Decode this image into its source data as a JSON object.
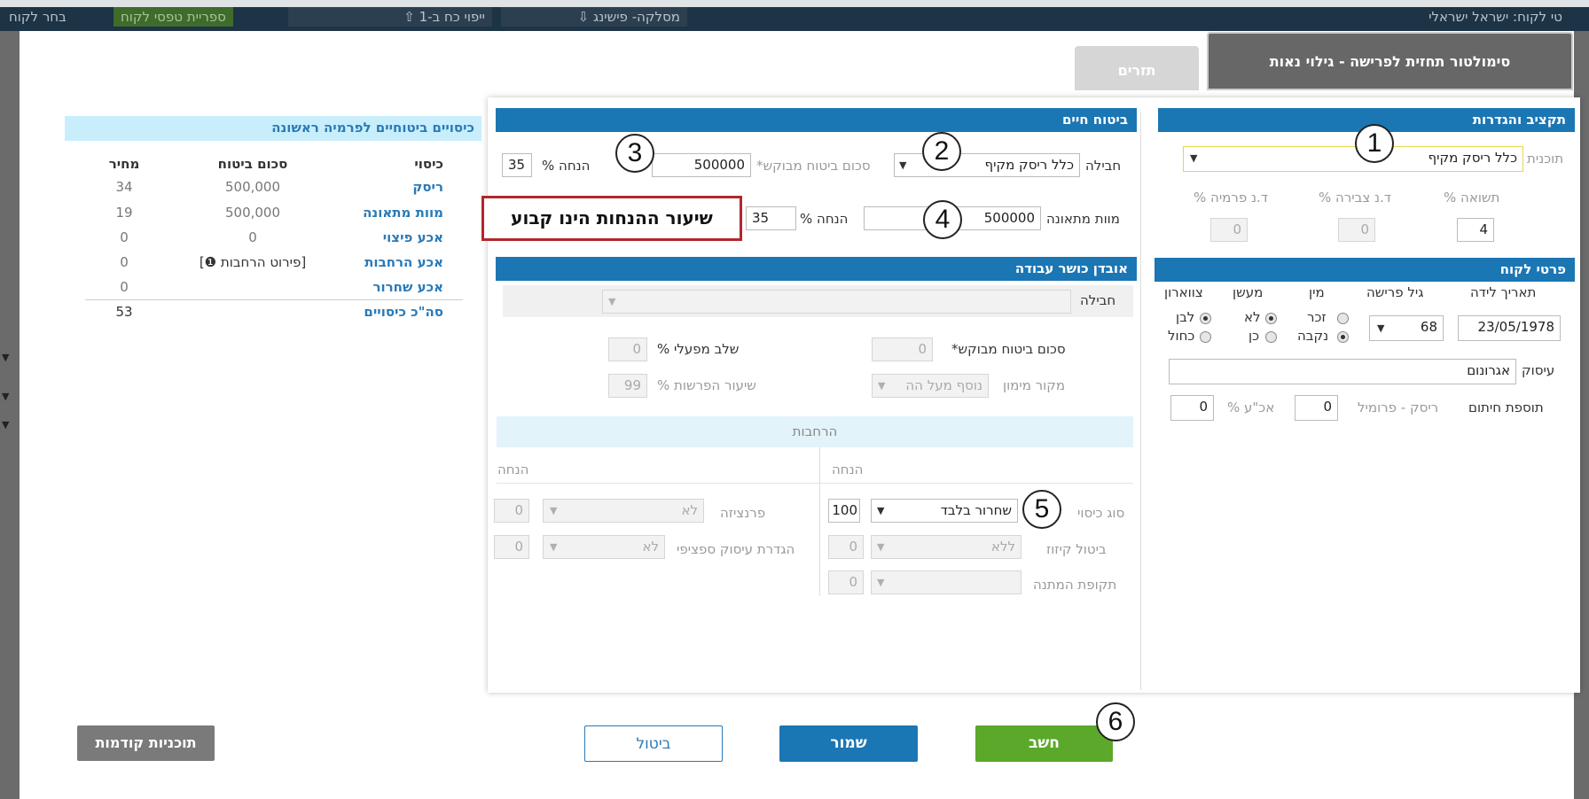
{
  "topbar": {
    "customer": "טי לקוח: ישראל ישראלי",
    "item1": "בחר לקוח",
    "item2": "ספריית טפסי לקוח",
    "item3": "ייפוי כח ב-1",
    "item4": "מסלקה- פישינג"
  },
  "tabs": {
    "main": "סימולטור תחזית לפרישה - גילוי נאות",
    "flows": "תזרים"
  },
  "budget": {
    "header": "תקציב והגדרות",
    "plan_label": "תוכנית",
    "plan_value": "כלל ריסק מקיף",
    "yield_label": "תשואה %",
    "yield_value": "4",
    "accum_fee_label": "ד.נ צבירה %",
    "accum_fee_value": "0",
    "premium_fee_label": "ד.נ פרמיה %",
    "premium_fee_value": "0"
  },
  "client": {
    "header": "פרטי לקוח",
    "birthdate_label": "תאריך לידה",
    "birthdate_value": "23/05/1978",
    "retire_age_label": "גיל פרישה",
    "retire_age_value": "68",
    "gender_label": "מין",
    "gender_male": "זכר",
    "gender_female": "נקבה",
    "smoker_label": "מעשן",
    "smoker_no": "לא",
    "smoker_yes": "כן",
    "collar_label": "צווארון",
    "collar_white": "לבן",
    "collar_blue": "כחול",
    "occupation_label": "עיסוק",
    "occupation_value": "אגרונום",
    "underwriting_label": "תוספת חיתום",
    "risk_label": "ריסק - פרומיל",
    "risk_value": "0",
    "ak_label": "אכ\"ע %",
    "ak_value": "0"
  },
  "life": {
    "header": "ביטוח חיים",
    "package_label": "חבילה",
    "package_value": "כלל ריסק מקיף",
    "sum_label": "סכום ביטוח מבוקש*",
    "sum_value": "500000",
    "discount_label": "הנחה %",
    "discount_value": "35",
    "accident_label": "מוות מתאונה",
    "accident_value": "500000",
    "discount2_label": "הנחה %",
    "discount2_value": "35",
    "note": "שיעור ההנחות הינו קבוע"
  },
  "disability": {
    "header": "אובדן כושר עבודה",
    "package_label": "חבילה",
    "sum_label": "סכום ביטוח מבוקש*",
    "sum_value": "0",
    "employer_label": "שלב מפעלי %",
    "employer_value": "0",
    "source_label": "מקור מימון",
    "source_value": "נוסף מעל הה",
    "deposit_label": "שיעור הפרשות %",
    "deposit_value": "99",
    "extensions_header": "הרחבות",
    "discount_col": "הנחה",
    "cover_type_label": "סוג כיסוי",
    "cover_type_value": "שחרור בלבד",
    "cover_type_discount": "100",
    "franchise_label": "פרנציזה",
    "franchise_value": "לא",
    "franchise_discount": "0",
    "offset_label": "ביטול קיזוז",
    "offset_value": "ללא",
    "offset_discount": "0",
    "occupation_def_label": "הגדרת עיסוק ספציפי",
    "occupation_def_value": "לא",
    "occupation_def_discount": "0",
    "wait_label": "תקופת המתנה",
    "wait_discount": "0"
  },
  "summary": {
    "header": "כיסויים ביטוחיים לפרמיה ראשונה",
    "col_cover": "כיסוי",
    "col_sum": "סכום ביטוח",
    "col_price": "מחיר",
    "rows": [
      {
        "cover": "ריסק",
        "sum": "500,000",
        "price": "34"
      },
      {
        "cover": "מוות מתאונה",
        "sum": "500,000",
        "price": "19"
      },
      {
        "cover": "אכע פיצוי",
        "sum": "0",
        "price": "0"
      },
      {
        "cover": "אכע הרחבות",
        "sum": "[פירוט הרחבות ❶]",
        "price": "0"
      },
      {
        "cover": "אכע שחרור",
        "sum": "",
        "price": "0"
      }
    ],
    "total_label": "סה\"כ כיסויים",
    "total_price": "53"
  },
  "buttons": {
    "calc": "חשב",
    "save": "שמור",
    "cancel": "ביטול",
    "previous": "תוכניות קודמות"
  },
  "callouts": [
    "1",
    "2",
    "3",
    "4",
    "5",
    "6"
  ]
}
